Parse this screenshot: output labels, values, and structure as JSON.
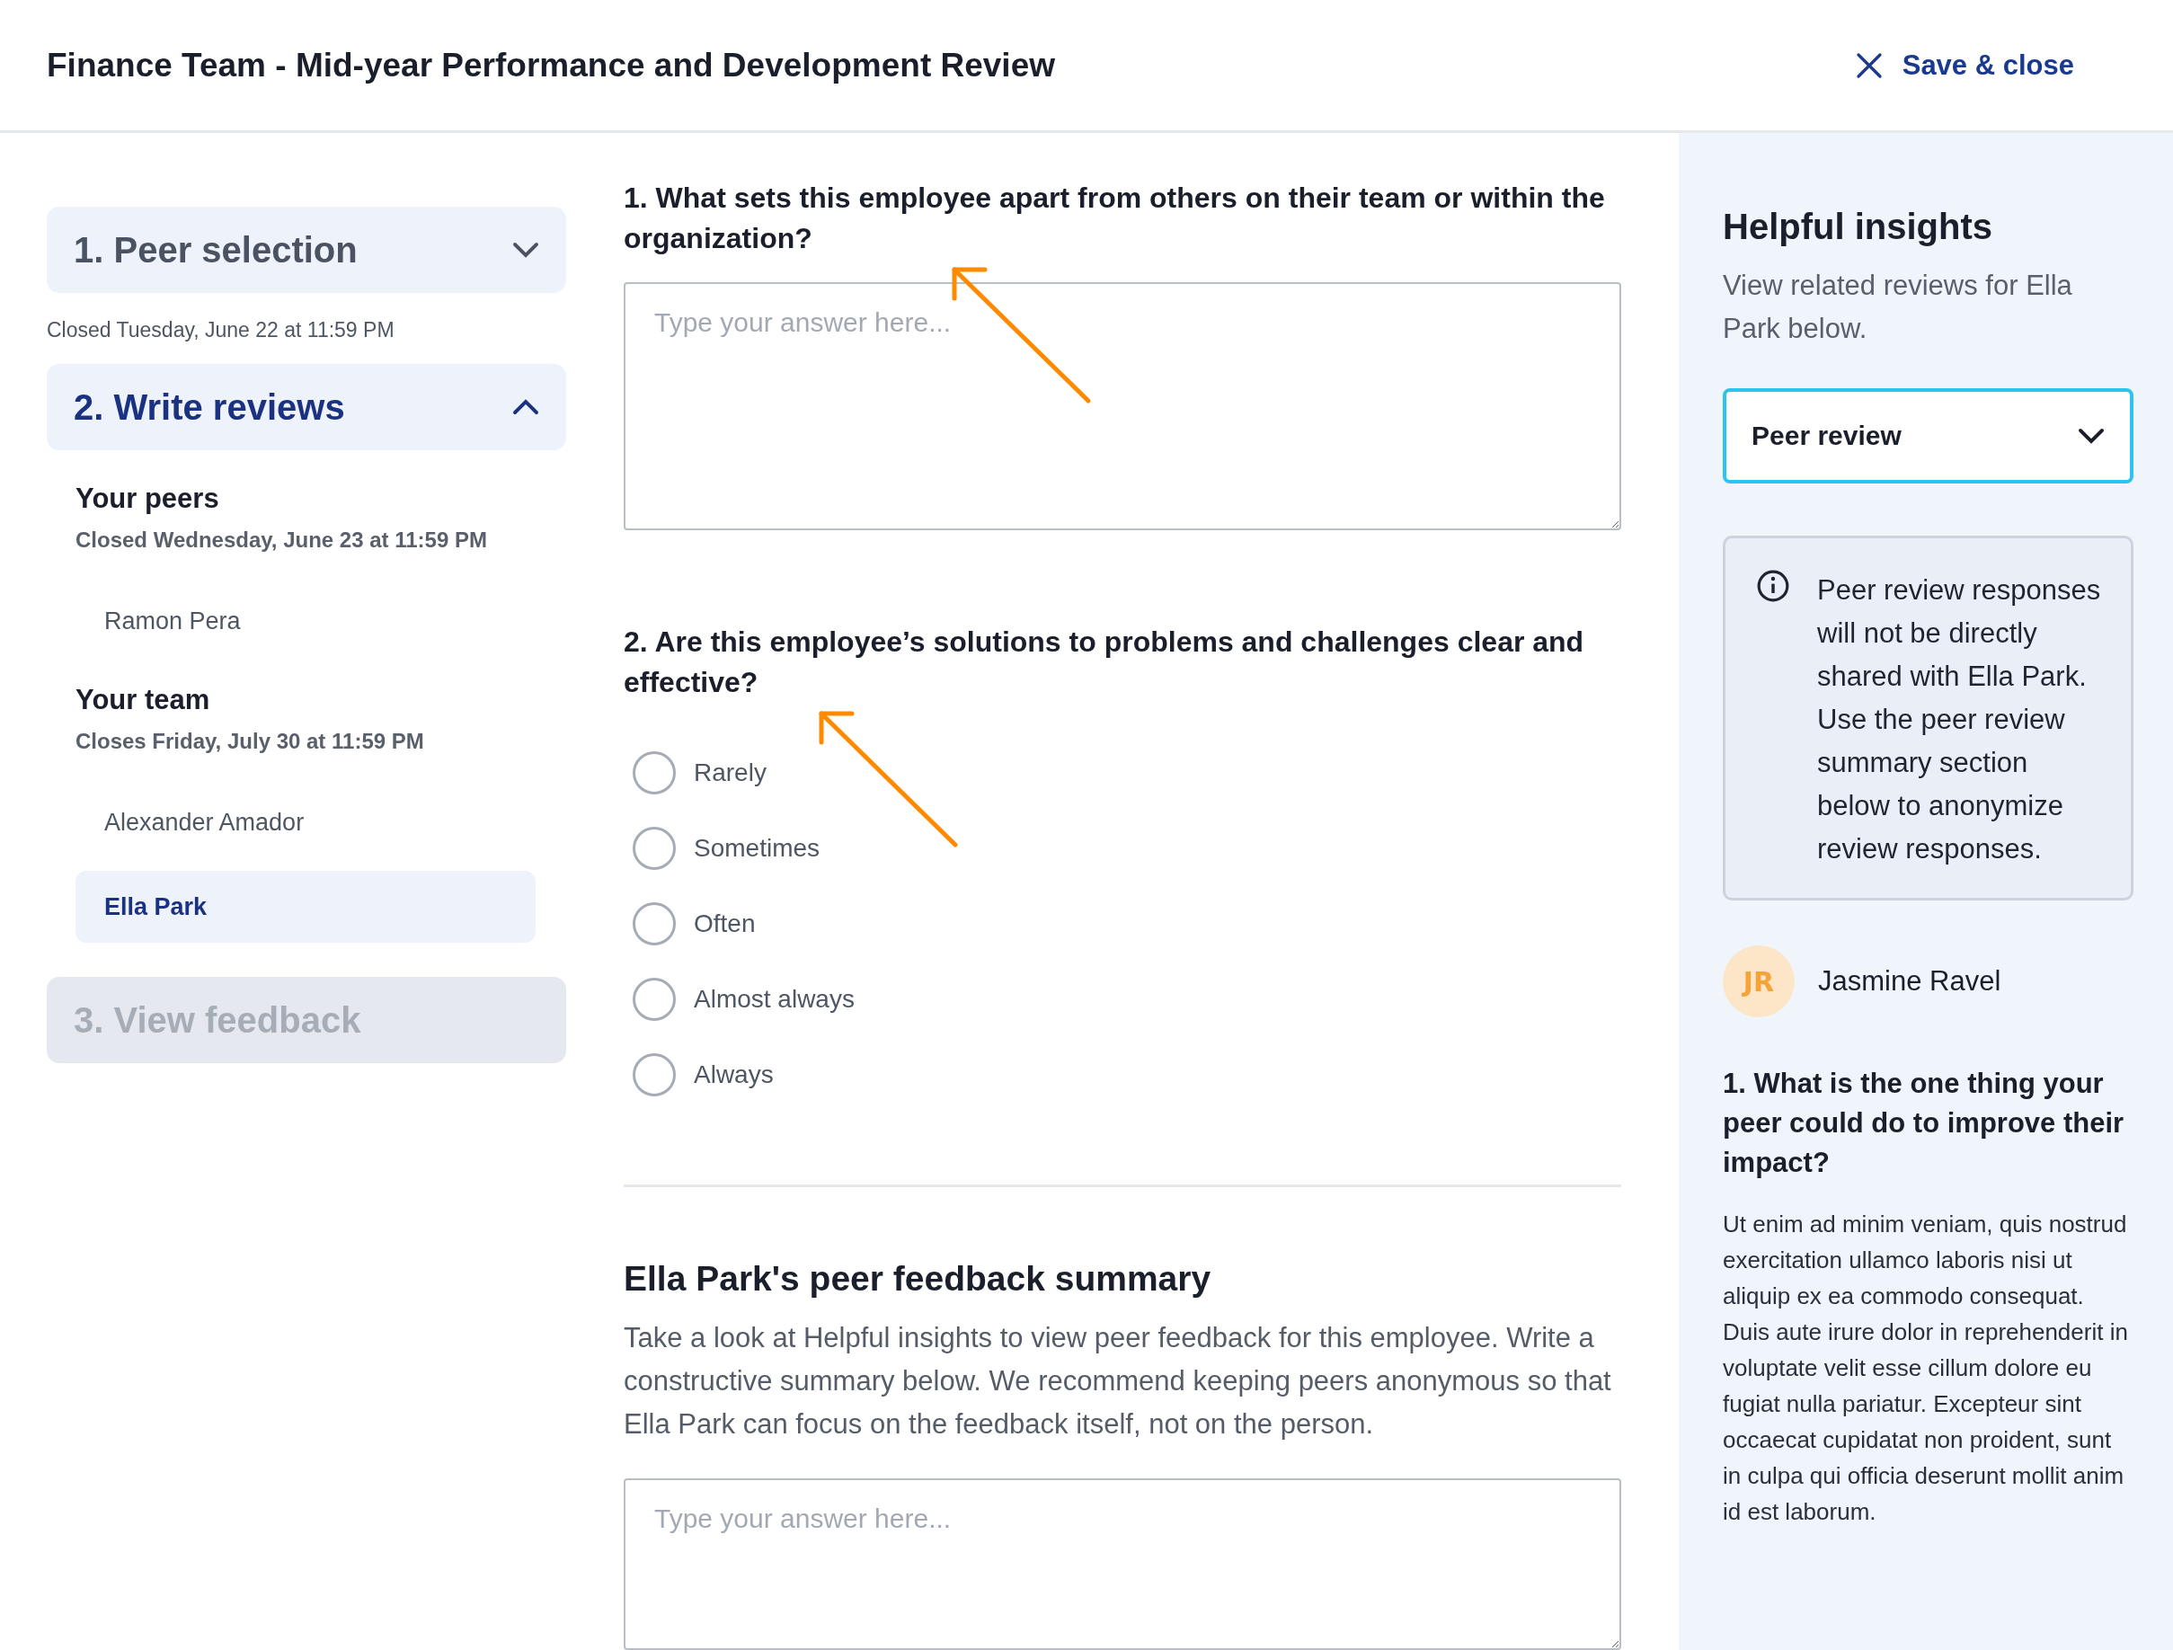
{
  "header": {
    "title": "Finance Team - Mid-year Performance and Development Review",
    "save_label": "Save & close"
  },
  "steps": [
    {
      "label": "1. Peer selection",
      "expanded": false,
      "disabled": false,
      "note": "Closed Tuesday, June 22 at 11:59 PM"
    },
    {
      "label": "2. Write reviews",
      "expanded": true,
      "disabled": false,
      "groups": [
        {
          "title": "Your peers",
          "deadline": "Closed Wednesday, June 23 at 11:59 PM",
          "people": [
            {
              "name": "Ramon Pera",
              "selected": false
            }
          ]
        },
        {
          "title": "Your team",
          "deadline": "Closes Friday, July 30 at 11:59 PM",
          "people": [
            {
              "name": "Alexander Amador",
              "selected": false
            },
            {
              "name": "Ella Park",
              "selected": true
            }
          ]
        }
      ]
    },
    {
      "label": "3. View feedback",
      "expanded": false,
      "disabled": true
    }
  ],
  "questions": [
    {
      "kind": "text",
      "title": "1. What sets this employee apart from others on their team or within the organization?",
      "placeholder": "Type your answer here..."
    },
    {
      "kind": "choice",
      "title": "2. Are this employee’s solutions to problems and challenges clear and effective?",
      "options": [
        {
          "label": "Rarely",
          "selected": false
        },
        {
          "label": "Sometimes",
          "selected": false
        },
        {
          "label": "Often",
          "selected": false
        },
        {
          "label": "Almost always",
          "selected": false
        },
        {
          "label": "Always",
          "selected": false
        }
      ]
    }
  ],
  "summary": {
    "title": "Ella Park's peer feedback summary",
    "description": "Take a look at Helpful insights to view peer feedback for this employee. Write a constructive summary below. We recommend keeping peers anonymous so that Ella Park can focus on the feedback itself, not on the person.",
    "placeholder": "Type your answer here..."
  },
  "insights": {
    "title": "Helpful insights",
    "subtitle": "View related reviews for Ella Park below.",
    "select": {
      "value": "Peer review"
    },
    "notice": "Peer review responses will not be directly shared with Ella Park. Use the peer review summary section below to anonymize review responses.",
    "review": {
      "initials": "JR",
      "name": "Jasmine Ravel",
      "question": "1. What is the one thing your peer could do to improve their impact?",
      "answer": "Ut enim ad minim veniam, quis nostrud exercitation ullamco laboris nisi ut aliquip ex ea commodo consequat. Duis aute irure dolor in reprehenderit in voluptate velit esse cillum dolore eu fugiat nulla pariatur. Excepteur sint occaecat cupidatat non proident, sunt in culpa qui officia deserunt mollit anim id est laborum."
    }
  }
}
